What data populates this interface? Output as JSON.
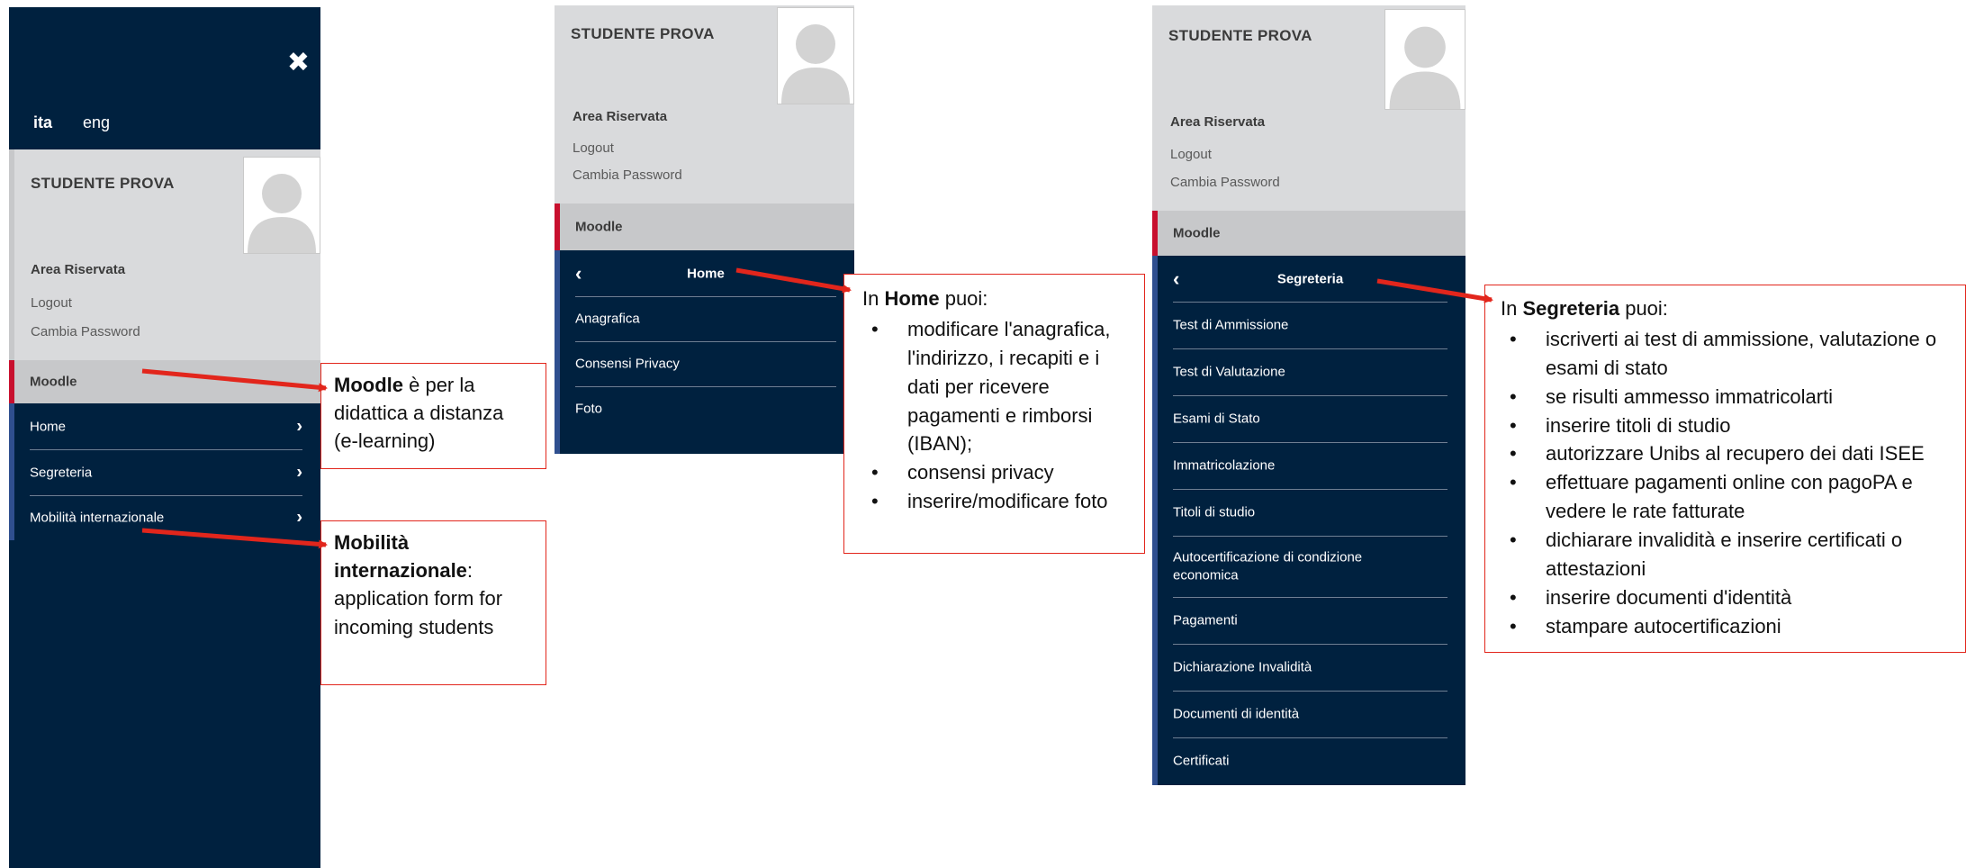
{
  "common": {
    "user_name": "STUDENTE PROVA",
    "area_riservata": "Area Riservata",
    "logout": "Logout",
    "cambia_password": "Cambia Password",
    "moodle": "Moodle"
  },
  "panel1": {
    "close_glyph": "✖",
    "lang_ita": "ita",
    "lang_eng": "eng",
    "menu": [
      {
        "label": "Home"
      },
      {
        "label": "Segreteria"
      },
      {
        "label": "Mobilità internazionale"
      }
    ]
  },
  "panel2": {
    "header": "Home",
    "items": [
      "Anagrafica",
      "Consensi Privacy",
      "Foto"
    ]
  },
  "panel3": {
    "header": "Segreteria",
    "items": [
      "Test di Ammissione",
      "Test di Valutazione",
      "Esami di Stato",
      "Immatricolazione",
      "Titoli di studio",
      "Autocertificazione di condizione economica",
      "Pagamenti",
      "Dichiarazione Invalidità",
      "Documenti di identità",
      "Certificati"
    ]
  },
  "callouts": {
    "moodle": {
      "bold": "Moodle",
      "rest": " è per la didattica a distanza (e-learning)"
    },
    "mobilita": {
      "bold": "Mobilità internazionale",
      "rest": ": application form for incoming students"
    },
    "home": {
      "pre": "In ",
      "bold": "Home",
      "post": " puoi:",
      "bullets": [
        "modificare l'anagrafica, l'indirizzo, i recapiti e i dati per ricevere pagamenti e rimborsi (IBAN);",
        "consensi privacy",
        "inserire/modificare foto"
      ]
    },
    "segreteria": {
      "pre": "In ",
      "bold": "Segreteria",
      "post": " puoi:",
      "bullets": [
        "iscriverti ai test di ammissione, valutazione o esami di stato",
        "se risulti ammesso immatricolarti",
        "inserire titoli di studio",
        "autorizzare Unibs al recupero dei dati ISEE",
        "effettuare pagamenti online con pagoPA e vedere le rate fatturate",
        "dichiarare invalidità e inserire certificati o attestazioni",
        "inserire documenti d'identità",
        "stampare autocertificazioni"
      ]
    }
  },
  "colors": {
    "panel_bg": "#00213f",
    "grey_bg": "#d9dadc",
    "moodle_accent": "#c8102e",
    "menu_accent": "#2f4f8f",
    "arrow": "#e2261c"
  }
}
